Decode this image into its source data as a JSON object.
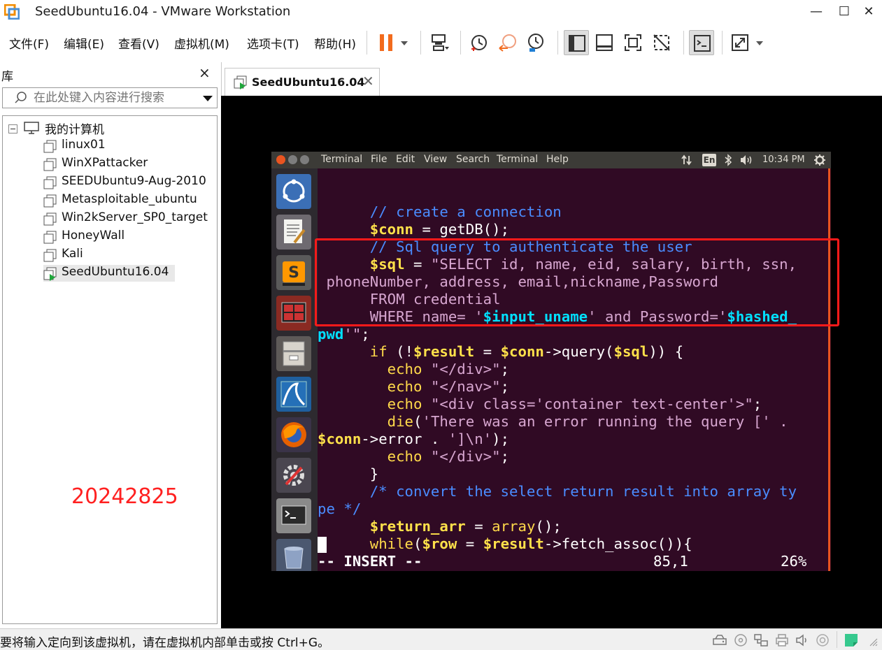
{
  "window": {
    "title": "SeedUbuntu16.04 - VMware Workstation",
    "minimize": "—",
    "maximize": "☐",
    "close": "✕"
  },
  "menu": {
    "file": "文件(F)",
    "edit": "编辑(E)",
    "view": "查看(V)",
    "vm": "虚拟机(M)",
    "tabs": "选项卡(T)",
    "help": "帮助(H)"
  },
  "library": {
    "title": "库",
    "close": "×",
    "search_placeholder": "在此处键入内容进行搜索",
    "root": "我的计算机",
    "vms": [
      "linux01",
      "WinXPattacker",
      "SEEDUbuntu9-Aug-2010",
      "Metasploitable_ubuntu",
      "Win2kServer_SP0_target",
      "HoneyWall",
      "Kali",
      "SeedUbuntu16.04"
    ],
    "watermark": "20242825"
  },
  "tab": {
    "label": "SeedUbuntu16.04",
    "close": "✕"
  },
  "ubuntu": {
    "menu": [
      "Terminal",
      "File",
      "Edit",
      "View",
      "Search",
      "Terminal",
      "Help"
    ],
    "keyboard": "En",
    "clock": "10:34 PM"
  },
  "terminal": {
    "l1": "      // create a connection",
    "l2a": "      ",
    "l2b": "$conn",
    "l2c": " = getDB();",
    "l3": "      // Sql query to authenticate the user",
    "l4a": "      ",
    "l4b": "$sql",
    "l4c": " = ",
    "l4d": "\"SELECT id, name, eid, salary, birth, ssn,",
    "l5": " phoneNumber, address, email,nickname,Password",
    "l6": "      FROM credential",
    "l7a": "      WHERE name= '",
    "l7b": "$input_uname",
    "l7c": "' and Password='",
    "l7d": "$hashed_",
    "l8a": "pwd",
    "l8b": "'\"",
    "l8c": ";",
    "l9a": "      ",
    "l9b": "if",
    "l9c": " (!",
    "l9d": "$result",
    "l9e": " = ",
    "l9f": "$conn",
    "l9g": "->query(",
    "l9h": "$sql",
    "l9i": ")) {",
    "l10a": "        ",
    "l10b": "echo",
    "l10c": " ",
    "l10d": "\"</div>\"",
    "l10e": ";",
    "l11a": "        ",
    "l11b": "echo",
    "l11c": " ",
    "l11d": "\"</nav>\"",
    "l11e": ";",
    "l12a": "        ",
    "l12b": "echo",
    "l12c": " ",
    "l12d": "\"<div class='container text-center'>\"",
    "l12e": ";",
    "l13a": "        ",
    "l13b": "die",
    "l13c": "(",
    "l13d": "'There was an error running the query [' .",
    "l14a": "$conn",
    "l14b": "->error . ",
    "l14c": "']\\n'",
    "l14d": ");",
    "l15a": "        ",
    "l15b": "echo",
    "l15c": " ",
    "l15d": "\"</div>\"",
    "l15e": ";",
    "l16": "      }",
    "l17": "      /* convert the select return result into array ty",
    "l18": "pe */",
    "l19a": "      ",
    "l19b": "$return_arr",
    "l19c": " = ",
    "l19d": "array",
    "l19e": "();",
    "l20a": "      ",
    "l20b": "while",
    "l20c": "(",
    "l20d": "$row",
    "l20e": " = ",
    "l20f": "$result",
    "l20g": "->fetch_assoc()){",
    "mode": "-- INSERT --",
    "pos": "85,1",
    "pct": "26%"
  },
  "status": {
    "text": "要将输入定向到该虚拟机，请在虚拟机内部单击或按 Ctrl+G。"
  },
  "colors": {
    "terminal_bg": "#300a24",
    "highlight": "#ff1a1a",
    "ubuntu_orange": "#e95420"
  }
}
